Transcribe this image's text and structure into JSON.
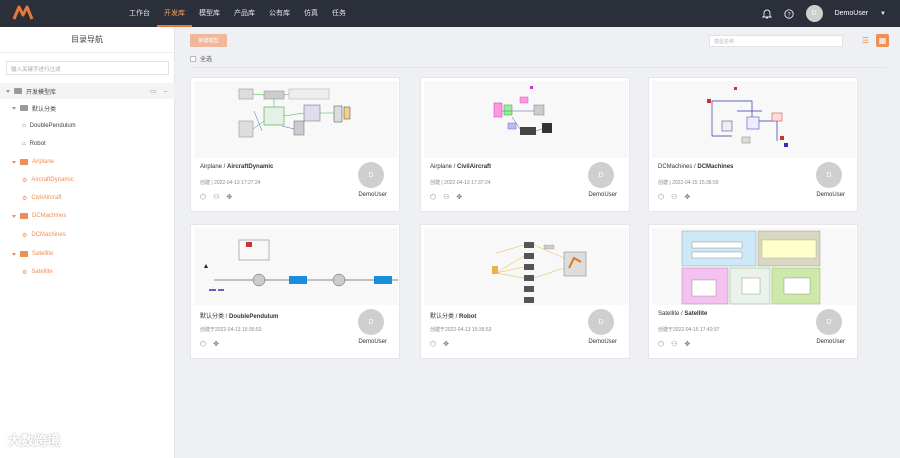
{
  "nav": {
    "items": [
      "工作台",
      "开发库",
      "模型库",
      "产品库",
      "公有库",
      "仿真",
      "任务"
    ],
    "active_index": 1
  },
  "user": {
    "avatar_initial": "D",
    "name": "DemoUser"
  },
  "sidebar": {
    "title": "目录导航",
    "search_placeholder": "输入关键字进行过滤",
    "root_label": "开发模型库",
    "items": [
      {
        "label": "默认分类",
        "level": 1,
        "kind": "category",
        "color": "gray"
      },
      {
        "label": "DoublePendulum",
        "level": 2,
        "kind": "model",
        "color": "gray"
      },
      {
        "label": "Robot",
        "level": 2,
        "kind": "model",
        "color": "gray"
      },
      {
        "label": "Airplane",
        "level": 1,
        "kind": "category",
        "color": "orange"
      },
      {
        "label": "AircraftDynamic",
        "level": 2,
        "kind": "model",
        "color": "orange"
      },
      {
        "label": "CivilAircraft",
        "level": 2,
        "kind": "model",
        "color": "orange"
      },
      {
        "label": "DCMachines",
        "level": 1,
        "kind": "category",
        "color": "orange"
      },
      {
        "label": "DCMachines",
        "level": 2,
        "kind": "model",
        "color": "orange"
      },
      {
        "label": "Satellite",
        "level": 1,
        "kind": "category",
        "color": "orange"
      },
      {
        "label": "Satellite",
        "level": 2,
        "kind": "model",
        "color": "orange"
      }
    ]
  },
  "toolbar": {
    "add_button": "新建模型",
    "search_placeholder": "模型名称",
    "select_all": "全选"
  },
  "cards": [
    {
      "category": "Airplane",
      "name": "AircraftDynamic",
      "meta": "创建 | 2022-04-13 17:27:24",
      "user": "DemoUser",
      "avatar": "D"
    },
    {
      "category": "Airplane",
      "name": "CivilAircraft",
      "meta": "创建 | 2022-04-13 17:37:24",
      "user": "DemoUser",
      "avatar": "D"
    },
    {
      "category": "DCMachines",
      "name": "DCMachines",
      "meta": "创建 | 2022-04-15 15:36:59",
      "user": "DemoUser",
      "avatar": "D"
    },
    {
      "category": "默认分类",
      "name": "DoublePendulum",
      "meta": "创建于2022-04-13 15:36:53",
      "user": "DemoUser",
      "avatar": "D"
    },
    {
      "category": "默认分类",
      "name": "Robot",
      "meta": "创建于2022-04-13 15:36:53",
      "user": "DemoUser",
      "avatar": "D"
    },
    {
      "category": "Satellite",
      "name": "Satellite",
      "meta": "创建于2022-04-15 17:40:37",
      "user": "DemoUser",
      "avatar": "D"
    }
  ],
  "watermark": "大数跨境",
  "colors": {
    "accent": "#ee8f55",
    "topbar": "#2b2f3a"
  }
}
